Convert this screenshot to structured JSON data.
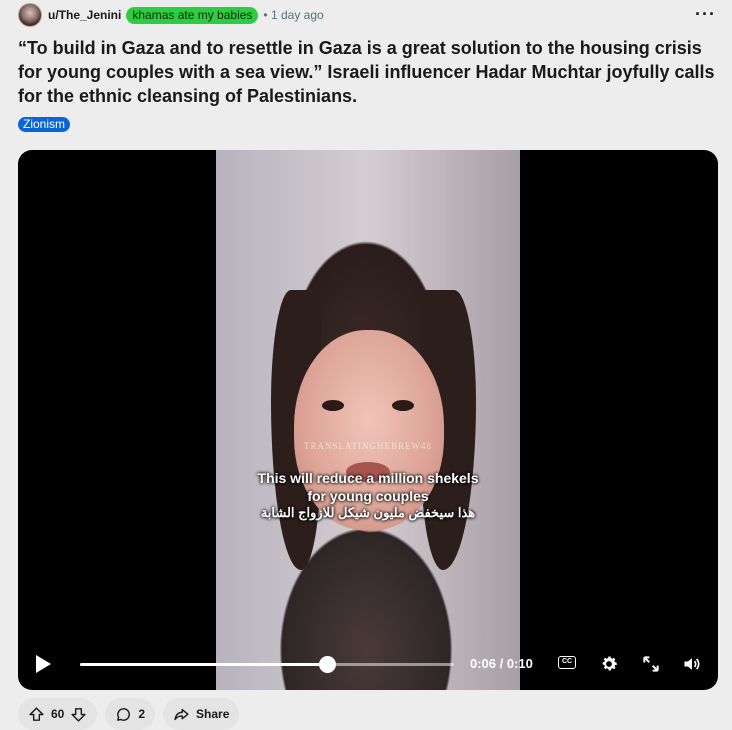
{
  "post": {
    "username": "u/The_Jenini",
    "flair": "khamas ate my babies",
    "time": "• 1 day ago",
    "more": "···",
    "title": "“To build in Gaza and to resettle in Gaza is a great solution to the housing crisis for young couples with a sea view.” Israeli influencer Hadar Muchtar joyfully calls for the ethnic cleansing of Palestinians.",
    "tag": "Zionism"
  },
  "video": {
    "watermark": "TRANSLATINGHEBREW48",
    "subtitle_line1": "This will reduce a million shekels",
    "subtitle_line2": "for young couples",
    "subtitle_line3": "هذا سيخفض مليون شيكل للازواج الشابة",
    "time": "0:06 / 0:10",
    "progress": 0.66,
    "cc_label": "CC"
  },
  "actions": {
    "votes": "60",
    "comments": "2",
    "share": "Share"
  },
  "colors": {
    "flair_bg": "#2ecc40",
    "tag_bg": "#0a66d6",
    "background": "#ededed"
  },
  "icons": [
    "avatar",
    "more-icon",
    "play-icon",
    "closed-captions-icon",
    "settings-gear-icon",
    "fullscreen-icon",
    "volume-icon",
    "upvote-icon",
    "downvote-icon",
    "comment-icon",
    "share-icon"
  ]
}
